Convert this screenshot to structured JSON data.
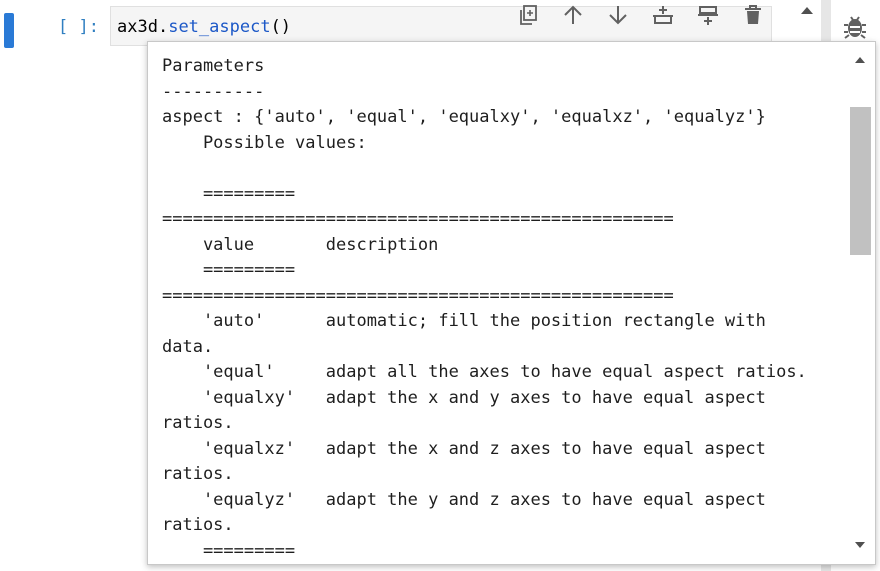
{
  "cell": {
    "prompt": "[ ]:",
    "code_object": "ax3d",
    "code_dot": ".",
    "code_method": "set_aspect",
    "code_parens": "()"
  },
  "toolbar": {
    "icons": [
      "duplicate-icon",
      "move-up-icon",
      "move-down-icon",
      "insert-above-icon",
      "insert-below-icon",
      "delete-icon"
    ]
  },
  "sidebar": {
    "icon": "debugger-bug-icon"
  },
  "tooltip": {
    "lines": [
      "Parameters",
      "----------",
      "aspect : {'auto', 'equal', 'equalxy', 'equalxz', 'equalyz'}",
      "    Possible values:",
      "",
      "    =========",
      "==================================================",
      "    value       description",
      "    =========",
      "==================================================",
      "    'auto'      automatic; fill the position rectangle with",
      "data.",
      "    'equal'     adapt all the axes to have equal aspect ratios.",
      "    'equalxy'   adapt the x and y axes to have equal aspect",
      "ratios.",
      "    'equalxz'   adapt the x and z axes to have equal aspect",
      "ratios.",
      "    'equalyz'   adapt the y and z axes to have equal aspect",
      "ratios.",
      "    ========="
    ]
  },
  "colors": {
    "cell_active_bar": "#2a7ad6",
    "prompt": "#307fc1",
    "method": "#1c58c7",
    "scroll_thumb": "#c1c1c1"
  }
}
